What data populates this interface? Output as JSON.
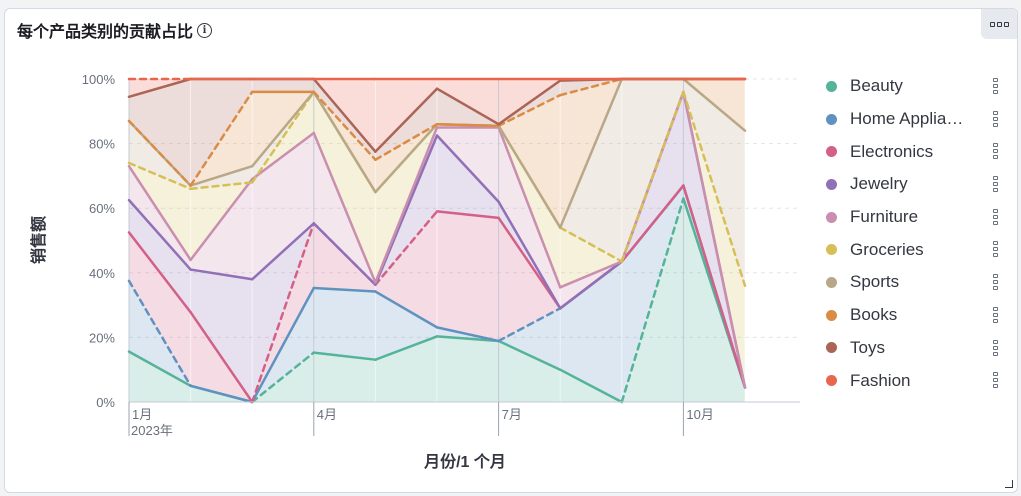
{
  "panel": {
    "title": "每个产品类别的贡献占比"
  },
  "chart_data": {
    "type": "area",
    "stacked": "percentage",
    "title": "每个产品类别的贡献占比",
    "xlabel": "月份/1 个月",
    "ylabel": "销售额",
    "x": [
      "2023-01",
      "2023-02",
      "2023-03",
      "2023-04",
      "2023-05",
      "2023-06",
      "2023-07",
      "2023-08",
      "2023-09",
      "2023-10",
      "2023-11"
    ],
    "x_tick_labels": [
      {
        "index": 0,
        "label": "1月",
        "sublabel": "2023年"
      },
      {
        "index": 3,
        "label": "4月",
        "sublabel": ""
      },
      {
        "index": 6,
        "label": "7月",
        "sublabel": ""
      },
      {
        "index": 9,
        "label": "10月",
        "sublabel": ""
      }
    ],
    "y_ticks": [
      "0%",
      "20%",
      "40%",
      "60%",
      "80%",
      "100%"
    ],
    "ylim": [
      0,
      100
    ],
    "grid": true,
    "legend_position": "right",
    "missing_months_shown_dashed": true,
    "series": [
      {
        "name": "Beauty",
        "color": "#54b399",
        "values": [
          15.6,
          5.0,
          0,
          15.3,
          13.1,
          20.3,
          18.9,
          10.0,
          0,
          63.0,
          4.5
        ]
      },
      {
        "name": "Home Appliances",
        "color": "#6092c0",
        "values": [
          37.5,
          5.0,
          0,
          35.3,
          34.2,
          23.1,
          18.9,
          29.0,
          43.5,
          67.0,
          4.5
        ]
      },
      {
        "name": "Electronics",
        "color": "#d36086",
        "values": [
          52.5,
          27.8,
          0,
          55.3,
          36.3,
          59.0,
          57.0,
          29.0,
          43.5,
          67.0,
          4.5
        ]
      },
      {
        "name": "Jewelry",
        "color": "#9170b8",
        "values": [
          62.5,
          41.0,
          38.0,
          55.3,
          36.3,
          82.5,
          62.0,
          29.0,
          43.5,
          96.0,
          4.5
        ]
      },
      {
        "name": "Furniture",
        "color": "#ca8eae",
        "values": [
          73.0,
          44.0,
          69.0,
          83.3,
          37.0,
          85.0,
          85.0,
          35.5,
          43.5,
          96.0,
          4.5
        ]
      },
      {
        "name": "Groceries",
        "color": "#d6bf57",
        "values": [
          74.0,
          66.0,
          68.0,
          96.0,
          65.0,
          86.0,
          85.5,
          54.0,
          43.5,
          96.0,
          36.0
        ]
      },
      {
        "name": "Sports",
        "color": "#b9a888",
        "values": [
          87.0,
          67.0,
          73.0,
          96.0,
          65.0,
          86.0,
          85.5,
          54.0,
          100,
          100,
          84.0
        ]
      },
      {
        "name": "Books",
        "color": "#da8b45",
        "values": [
          87.0,
          67.0,
          96.0,
          96.0,
          75.0,
          86.0,
          85.5,
          95.0,
          100,
          100,
          100
        ]
      },
      {
        "name": "Toys",
        "color": "#aa6556",
        "values": [
          94.5,
          100,
          100,
          100,
          77.5,
          97.0,
          86.0,
          99.5,
          100,
          100,
          100
        ]
      },
      {
        "name": "Fashion",
        "color": "#e7664c",
        "values": [
          100,
          100,
          100,
          100,
          100,
          100,
          100,
          100,
          100,
          100,
          100
        ]
      }
    ],
    "dashed_segments": {
      "Beauty": [
        2,
        8
      ],
      "Home Appliances": [
        0,
        6
      ],
      "Electronics": [
        2,
        3,
        4
      ],
      "Jewelry": [],
      "Furniture": [],
      "Groceries": [
        0,
        1,
        2,
        4,
        7,
        8,
        9
      ],
      "Sports": [],
      "Books": [
        0,
        1,
        3,
        4,
        6,
        7
      ],
      "Toys": [],
      "Fashion": [
        0
      ]
    }
  }
}
